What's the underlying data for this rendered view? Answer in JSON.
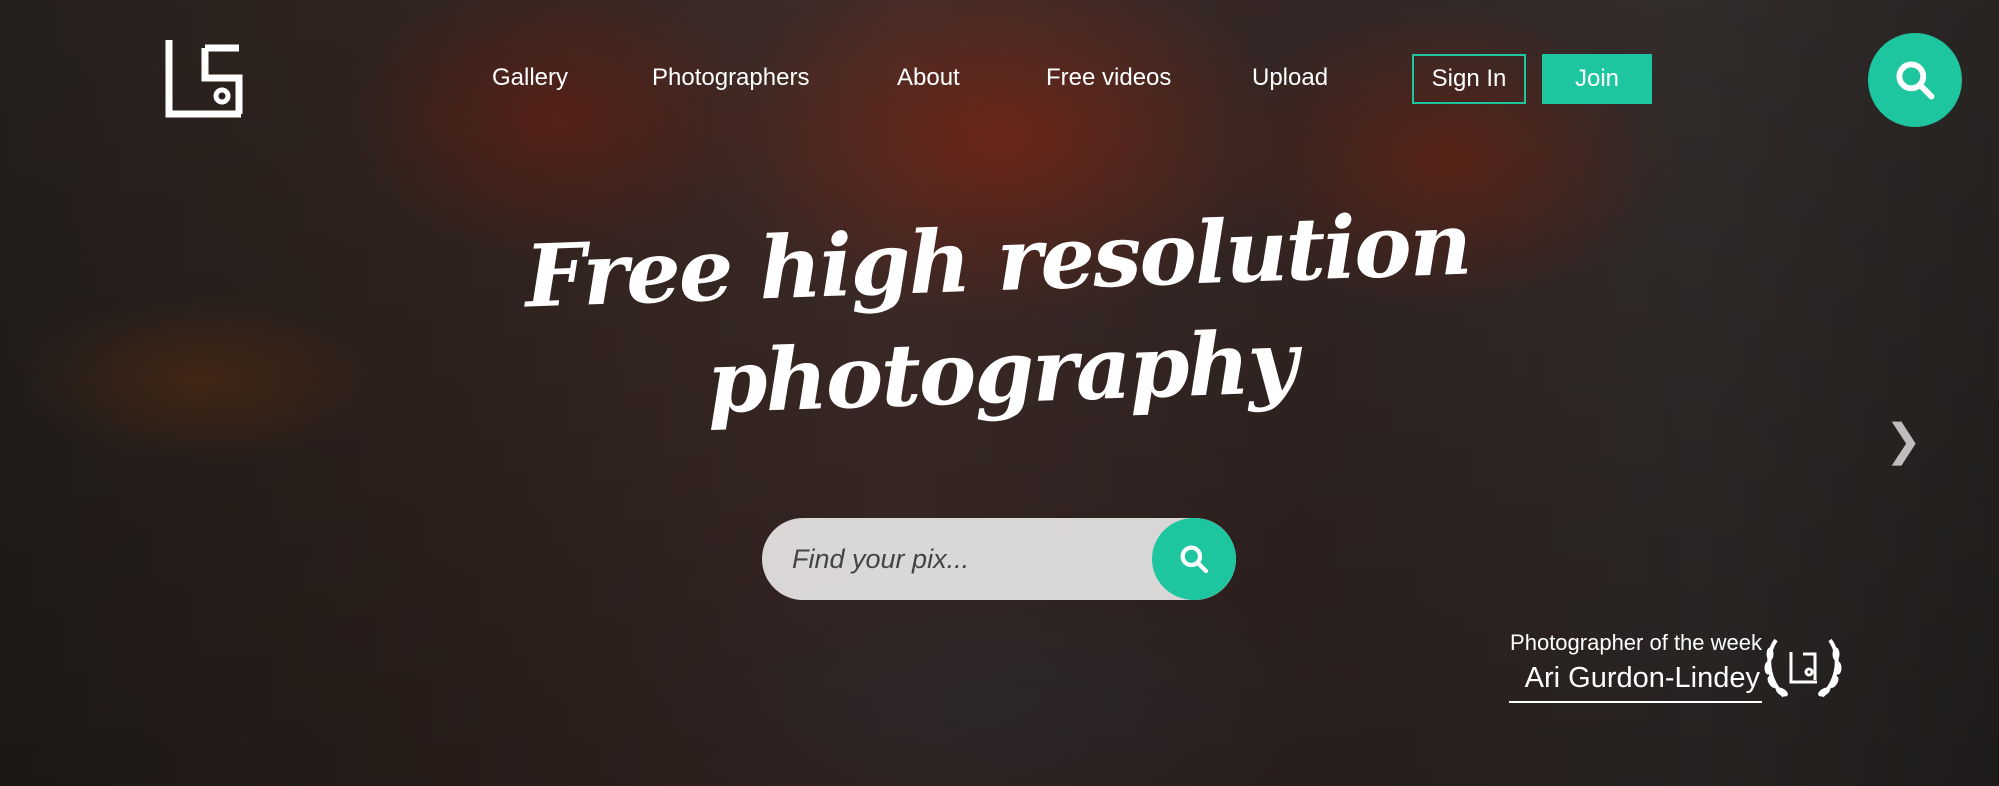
{
  "nav": {
    "items": [
      "Gallery",
      "Photographers",
      "About",
      "Free videos",
      "Upload"
    ],
    "sign_in": "Sign In",
    "join": "Join"
  },
  "hero": {
    "title_line1": "Free high resolution",
    "title_line2": "photography"
  },
  "search": {
    "placeholder": "Find your pix..."
  },
  "featured": {
    "label": "Photographer of the week",
    "name": "Ari Gurdon-Lindey"
  },
  "colors": {
    "accent": "#1ec6a0"
  }
}
